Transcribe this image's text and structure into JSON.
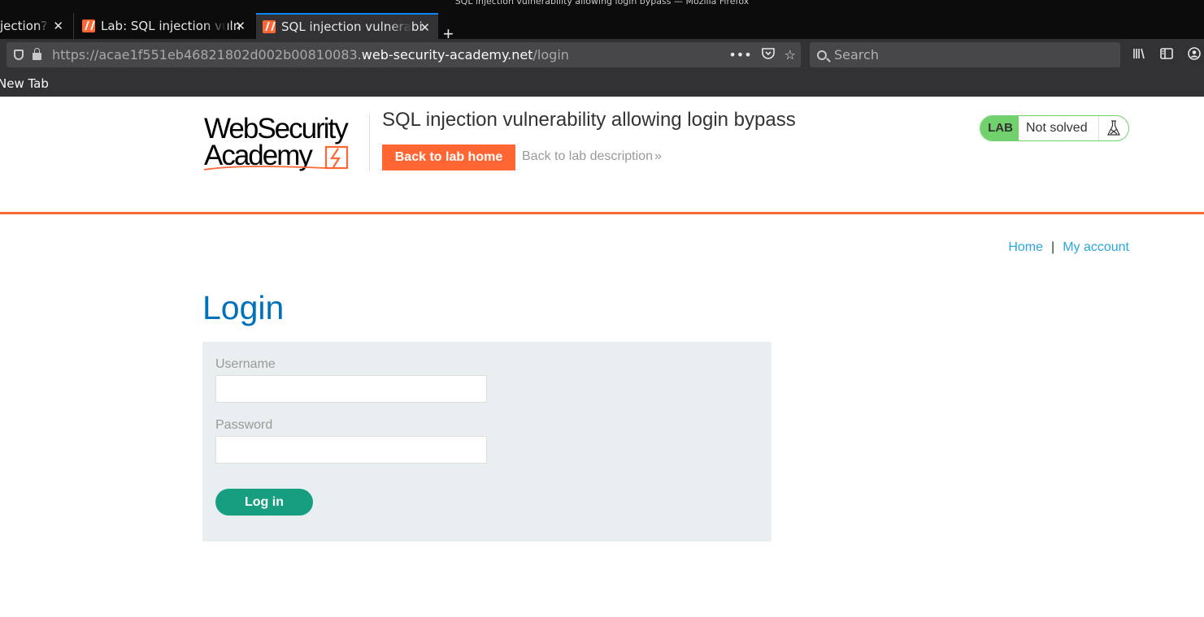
{
  "browser": {
    "window_title": "SQL injection vulnerability allowing login bypass — Mozilla Firefox",
    "tabs": [
      {
        "label": "jection?",
        "active": false
      },
      {
        "label": "Lab: SQL injection vuln",
        "active": false
      },
      {
        "label": "SQL injection vulnerabi",
        "active": true
      }
    ],
    "new_tab_symbol": "+",
    "url": {
      "prefix": "https://acae1f551eb46821802d002b00810083.",
      "host": "web-security-academy.net",
      "path": "/login"
    },
    "url_actions": [
      "more-icon",
      "pocket-icon",
      "bookmark-star-icon"
    ],
    "search_placeholder": "Search",
    "toolbar_icons": [
      "library-icon",
      "sidebar-icon",
      "account-icon"
    ],
    "bookmarks": [
      {
        "label": "New Tab"
      }
    ]
  },
  "lab_header": {
    "logo_line1": "WebSecurity",
    "logo_line2": "Academy",
    "title": "SQL injection vulnerability allowing login bypass",
    "back_home_label": "Back to lab home",
    "back_description_label": "Back to lab description",
    "status_badge": "LAB",
    "status_text": "Not solved",
    "colors": {
      "accent": "#ff6633",
      "status_green": "#70d16d"
    }
  },
  "nav": {
    "home": "Home",
    "separator": "|",
    "my_account": "My account"
  },
  "login": {
    "title": "Login",
    "username_label": "Username",
    "username_value": "",
    "password_label": "Password",
    "password_value": "",
    "submit_label": "Log in",
    "colors": {
      "title": "#0071bc",
      "button": "#179d7f",
      "panel": "#e9eff1"
    }
  }
}
